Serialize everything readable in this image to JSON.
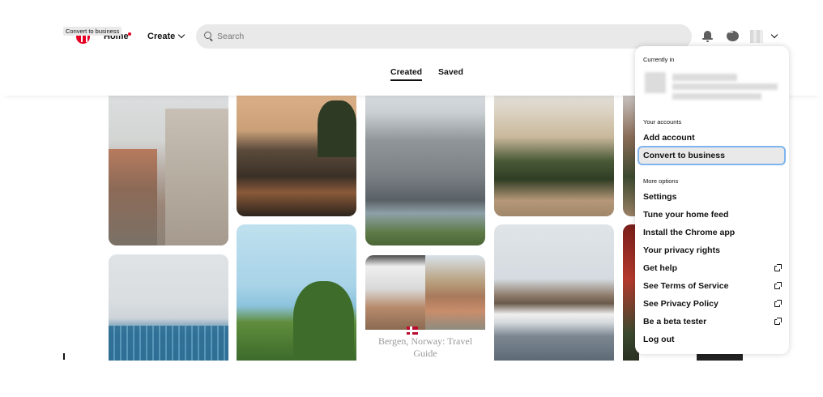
{
  "header": {
    "tooltip": "Convert to business",
    "nav_home": "Home",
    "nav_create": "Create",
    "search_placeholder": "Search"
  },
  "tabs": {
    "created": "Created",
    "saved": "Saved"
  },
  "pins": [
    {
      "title": "Bergen, Norway: Travel Guide"
    }
  ],
  "menu": {
    "currently_in": "Currently in",
    "your_accounts": "Your accounts",
    "add_account": "Add account",
    "convert_to_business": "Convert to business",
    "more_options": "More options",
    "settings": "Settings",
    "tune_home_feed": "Tune your home feed",
    "install_chrome_app": "Install the Chrome app",
    "privacy_rights": "Your privacy rights",
    "get_help": "Get help",
    "terms_of_service": "See Terms of Service",
    "privacy_policy": "See Privacy Policy",
    "beta_tester": "Be a beta tester",
    "log_out": "Log out"
  },
  "icons": {
    "logo": "pinterest-logo-icon",
    "search": "search-icon",
    "notifications": "bell-icon",
    "messages": "chat-bubble-icon",
    "account_menu": "chevron-down-icon",
    "external": "external-link-icon",
    "flag": "norway-flag-icon"
  },
  "colors": {
    "brand": "#e60023",
    "focus_ring": "#7fb4ee",
    "search_bg": "#e9e9e9"
  }
}
